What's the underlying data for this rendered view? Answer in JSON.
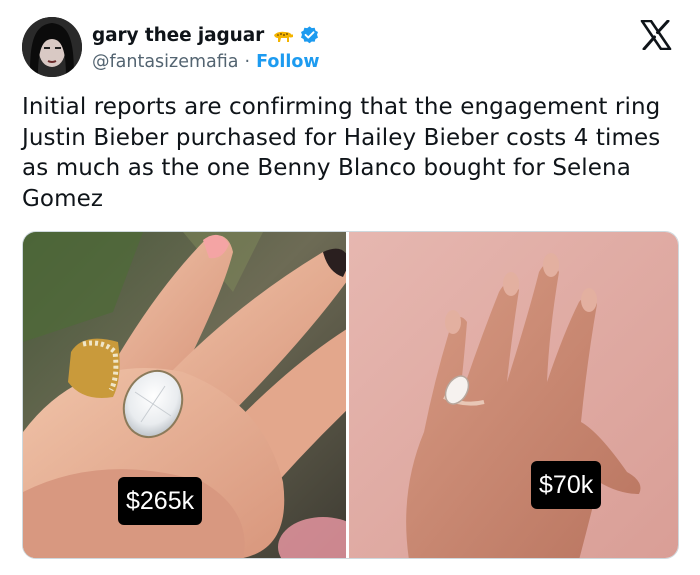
{
  "author": {
    "display_name": "gary thee jaguar",
    "handle": "@fantasizemafia",
    "separator": "·",
    "follow_label": "Follow",
    "avatar_icon": "avatar-photo",
    "badge_icons": [
      "jaguar-emoji-icon",
      "verified-badge-icon"
    ]
  },
  "platform_icon": "x-logo-icon",
  "tweet": {
    "text": "Initial reports are confirming that the engagement ring Justin Bieber purchased for Hailey Bieber costs 4 times as much as the one Benny Blanco bought for Selena Gomez"
  },
  "media": {
    "images": [
      {
        "price_label": "$265k"
      },
      {
        "price_label": "$70k"
      }
    ]
  },
  "colors": {
    "accent": "#1d9bf0",
    "text_primary": "#0f1419",
    "text_secondary": "#536471",
    "price_tag_bg": "#000000"
  }
}
